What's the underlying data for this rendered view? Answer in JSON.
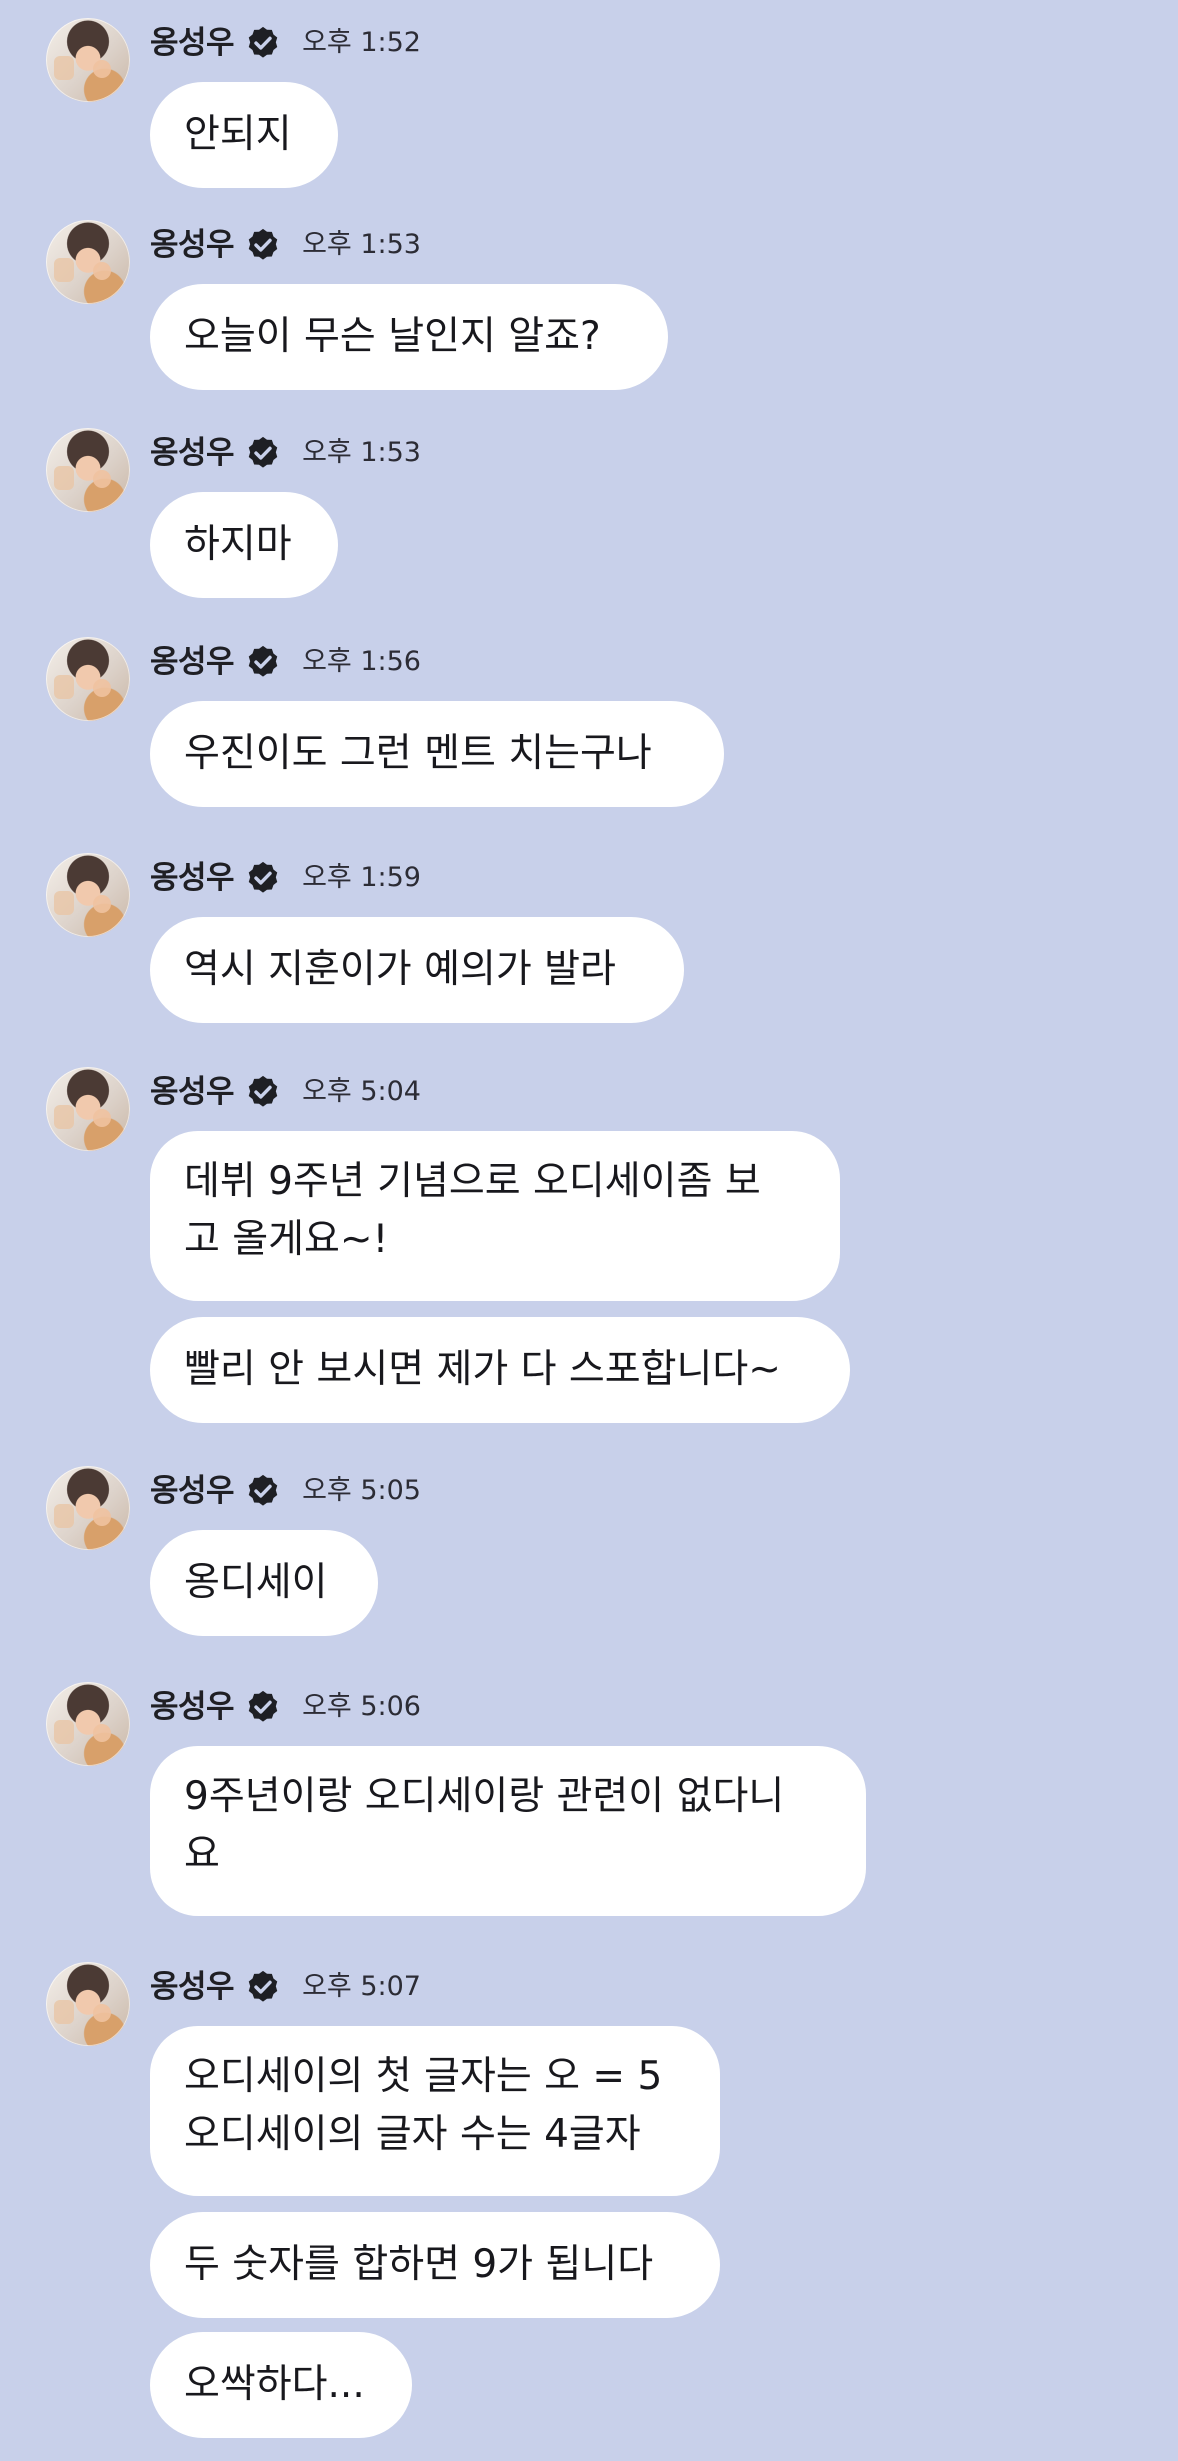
{
  "messages": [
    {
      "sender": "옹성우",
      "time": "오후 1:52",
      "bubbles": [
        "안되지"
      ]
    },
    {
      "sender": "옹성우",
      "time": "오후 1:53",
      "bubbles": [
        "오늘이 무슨 날인지 알죠?"
      ]
    },
    {
      "sender": "옹성우",
      "time": "오후 1:53",
      "bubbles": [
        "하지마"
      ]
    },
    {
      "sender": "옹성우",
      "time": "오후 1:56",
      "bubbles": [
        "우진이도 그런 멘트 치는구나"
      ]
    },
    {
      "sender": "옹성우",
      "time": "오후 1:59",
      "bubbles": [
        "역시 지훈이가 예의가 발라"
      ]
    },
    {
      "sender": "옹성우",
      "time": "오후 5:04",
      "bubbles": [
        "데뷔 9주년 기념으로 오디세이좀 보\n고 올게요~!",
        "빨리 안 보시면 제가 다 스포합니다~"
      ]
    },
    {
      "sender": "옹성우",
      "time": "오후 5:05",
      "bubbles": [
        "옹디세이"
      ]
    },
    {
      "sender": "옹성우",
      "time": "오후 5:06",
      "bubbles": [
        "9주년이랑 오디세이랑 관련이 없다니\n요"
      ]
    },
    {
      "sender": "옹성우",
      "time": "오후 5:07",
      "bubbles": [
        "오디세이의 첫 글자는 오 = 5\n오디세이의 글자 수는 4글자",
        "두 숫자를 합하면 9가 됩니다",
        "오싹하다..."
      ]
    }
  ]
}
